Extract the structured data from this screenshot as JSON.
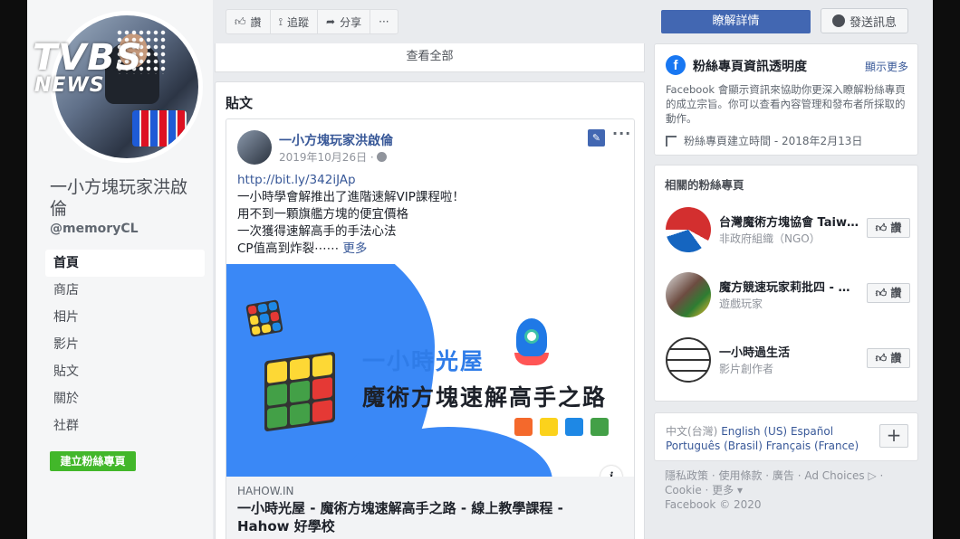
{
  "page": {
    "name": "一小方塊玩家洪啟倫",
    "handle": "@memoryCL"
  },
  "logo": {
    "line1": "TVBS",
    "line2": "NEWS"
  },
  "nav": {
    "items": [
      "首頁",
      "商店",
      "相片",
      "影片",
      "貼文",
      "關於",
      "社群"
    ],
    "active": "首頁",
    "create_page": "建立粉絲專頁"
  },
  "actions": {
    "like": "讚",
    "follow": "追蹤",
    "share": "分享",
    "more": "···"
  },
  "see_all": "查看全部",
  "posts": {
    "header": "貼文",
    "post": {
      "author": "一小方塊玩家洪啟倫",
      "date": "2019年10月26日 ·",
      "more": "···",
      "link": "http://bit.ly/342iJAp",
      "lines": [
        "一小時學會解推出了進階速解VIP課程啦！",
        "用不到一顆旗艦方塊的便宜價格",
        "一次獲得速解高手的手法心法",
        "CP值高到炸裂⋯⋯"
      ],
      "see_more": "更多",
      "image": {
        "title": "一小時光屋",
        "subtitle": "魔術方塊速解高手之路",
        "info": "i"
      },
      "link_domain": "HAHOW.IN",
      "link_title": "一小時光屋 - 魔術方塊速解高手之路 - 線上教學課程 - Hahow 好學校"
    }
  },
  "right": {
    "learn_more": "瞭解詳情",
    "send_message": "發送訊息",
    "transparency": {
      "title": "粉絲專頁資訊透明度",
      "see_more": "顯示更多",
      "description": "Facebook 會顯示資訊來協助你更深入瞭解粉絲專頁的成立宗旨。你可以查看內容管理和發布者所採取的動作。",
      "created": "粉絲專頁建立時間 - 2018年2月13日"
    },
    "related": {
      "title": "相關的粉絲專頁",
      "like": "讚",
      "items": [
        {
          "name": "台灣魔術方塊協會 Taiw…",
          "category": "非政府組織（NGO）"
        },
        {
          "name": "魔方競速玩家莉批四 - …",
          "category": "遊戲玩家"
        },
        {
          "name": "一小時過生活",
          "category": "影片創作者"
        }
      ]
    },
    "languages": {
      "current": "中文(台灣)",
      "others": [
        "English (US)",
        "Español",
        "Português (Brasil)",
        "Français (France)"
      ],
      "plus": "+"
    },
    "footer": {
      "line1": "隱私政策 · 使用條款 · 廣告 · Ad Choices ▷ ·",
      "line2": "Cookie · 更多 ▾",
      "line3": "Facebook © 2020"
    }
  },
  "colors": {
    "brand_blue": "#4267b2",
    "link_blue": "#385898",
    "green": "#42b72a",
    "image_blue": "#3a88f6"
  }
}
